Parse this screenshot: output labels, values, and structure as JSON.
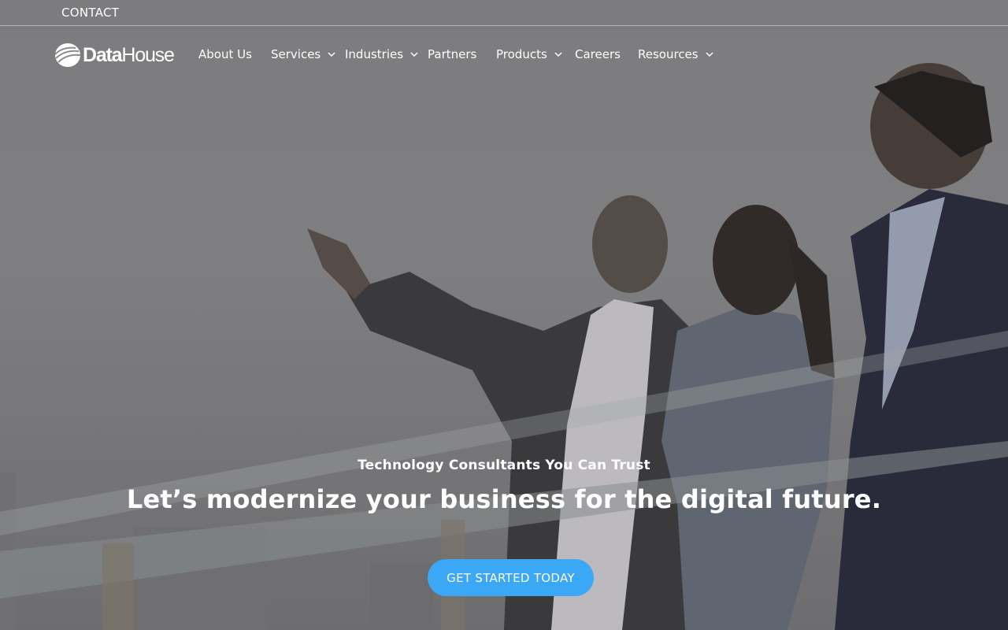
{
  "utility": {
    "contact_label": "CONTACT"
  },
  "logo": {
    "text_bold": "Data",
    "text_light": "House"
  },
  "nav": {
    "items": [
      {
        "label": "About Us",
        "has_dropdown": false
      },
      {
        "label": "Services",
        "has_dropdown": true
      },
      {
        "label": "Industries",
        "has_dropdown": true
      },
      {
        "label": "Partners",
        "has_dropdown": false
      },
      {
        "label": "Products",
        "has_dropdown": true
      },
      {
        "label": "Careers",
        "has_dropdown": false
      },
      {
        "label": "Resources",
        "has_dropdown": true
      }
    ]
  },
  "hero": {
    "tagline": "Technology Consultants You Can Trust",
    "headline": "Let’s modernize your business for the digital future.",
    "cta_label": "GET STARTED TODAY"
  },
  "colors": {
    "cta_background": "#3aa8f5",
    "text": "#ffffff"
  }
}
